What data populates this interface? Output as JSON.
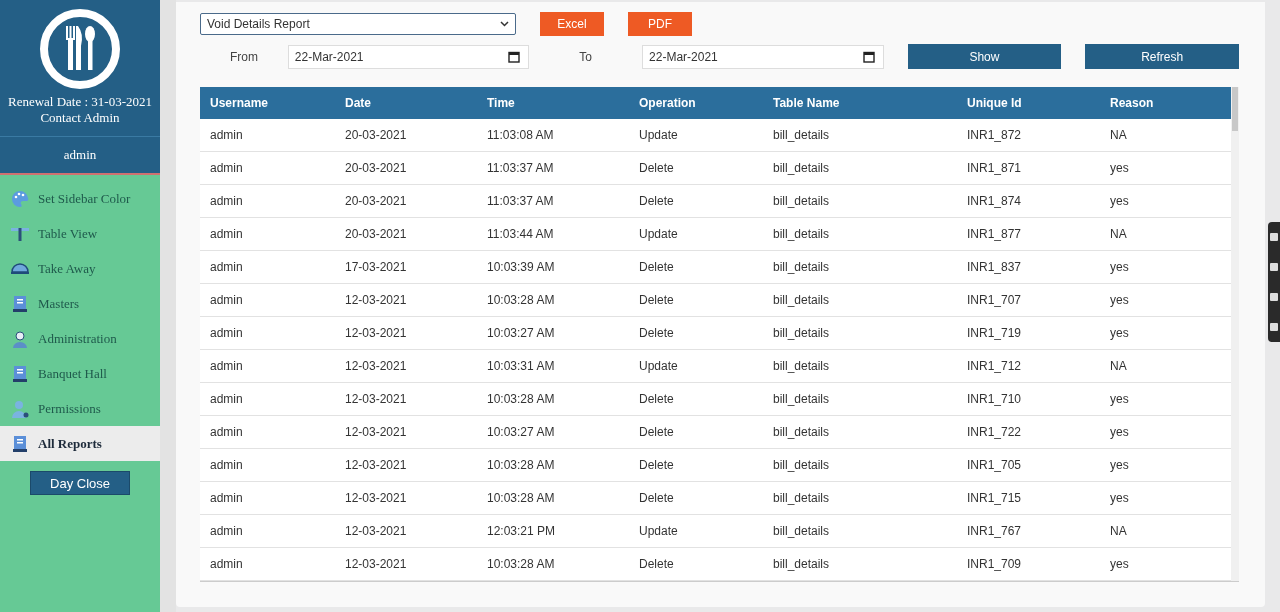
{
  "sidebar": {
    "renewal": "Renewal Date : 31-03-2021",
    "contact": "Contact Admin",
    "user": "admin",
    "items": [
      {
        "label": "Set Sidebar Color",
        "kind": "palette",
        "selected": false
      },
      {
        "label": "Table View",
        "kind": "table",
        "selected": false
      },
      {
        "label": "Take Away",
        "kind": "bell",
        "selected": false
      },
      {
        "label": "Masters",
        "kind": "book",
        "selected": false
      },
      {
        "label": "Administration",
        "kind": "person",
        "selected": false
      },
      {
        "label": "Banquet Hall",
        "kind": "book",
        "selected": false
      },
      {
        "label": "Permissions",
        "kind": "users",
        "selected": false
      },
      {
        "label": "All Reports",
        "kind": "book",
        "selected": true
      }
    ],
    "day_close": "Day Close"
  },
  "filters": {
    "report": "Void Details Report",
    "excel": "Excel",
    "pdf": "PDF",
    "from_label": "From",
    "from": "22-Mar-2021",
    "to_label": "To",
    "to": "22-Mar-2021",
    "show": "Show",
    "refresh": "Refresh"
  },
  "table": {
    "columns": [
      "Username",
      "Date",
      "Time",
      "Operation",
      "Table Name",
      "Unique Id",
      "Reason"
    ],
    "rows": [
      [
        "admin",
        "20-03-2021",
        "11:03:08 AM",
        "Update",
        "bill_details",
        "INR1_872",
        "NA"
      ],
      [
        "admin",
        "20-03-2021",
        "11:03:37 AM",
        "Delete",
        "bill_details",
        "INR1_871",
        "yes"
      ],
      [
        "admin",
        "20-03-2021",
        "11:03:37 AM",
        "Delete",
        "bill_details",
        "INR1_874",
        "yes"
      ],
      [
        "admin",
        "20-03-2021",
        "11:03:44 AM",
        "Update",
        "bill_details",
        "INR1_877",
        "NA"
      ],
      [
        "admin",
        "17-03-2021",
        "10:03:39 AM",
        "Delete",
        "bill_details",
        "INR1_837",
        "yes"
      ],
      [
        "admin",
        "12-03-2021",
        "10:03:28 AM",
        "Delete",
        "bill_details",
        "INR1_707",
        "yes"
      ],
      [
        "admin",
        "12-03-2021",
        "10:03:27 AM",
        "Delete",
        "bill_details",
        "INR1_719",
        "yes"
      ],
      [
        "admin",
        "12-03-2021",
        "10:03:31 AM",
        "Update",
        "bill_details",
        "INR1_712",
        "NA"
      ],
      [
        "admin",
        "12-03-2021",
        "10:03:28 AM",
        "Delete",
        "bill_details",
        "INR1_710",
        "yes"
      ],
      [
        "admin",
        "12-03-2021",
        "10:03:27 AM",
        "Delete",
        "bill_details",
        "INR1_722",
        "yes"
      ],
      [
        "admin",
        "12-03-2021",
        "10:03:28 AM",
        "Delete",
        "bill_details",
        "INR1_705",
        "yes"
      ],
      [
        "admin",
        "12-03-2021",
        "10:03:28 AM",
        "Delete",
        "bill_details",
        "INR1_715",
        "yes"
      ],
      [
        "admin",
        "12-03-2021",
        "12:03:21 PM",
        "Update",
        "bill_details",
        "INR1_767",
        "NA"
      ],
      [
        "admin",
        "12-03-2021",
        "10:03:28 AM",
        "Delete",
        "bill_details",
        "INR1_709",
        "yes"
      ]
    ]
  }
}
